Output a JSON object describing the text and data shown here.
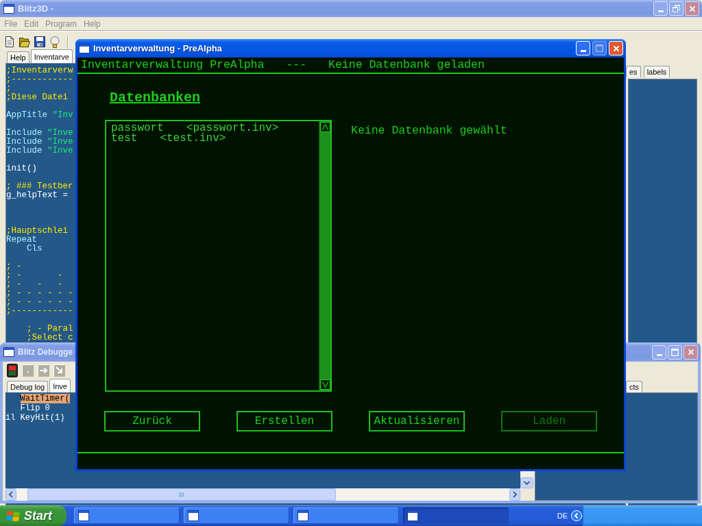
{
  "main_window": {
    "title": "Blitz3D -",
    "active": false,
    "menu": [
      "File",
      "Edit",
      "Program",
      "Help"
    ],
    "tabs": [
      {
        "label": "Help",
        "selected": false
      },
      {
        "label": "Inventarve",
        "selected": true
      }
    ],
    "code_lines": [
      {
        "kind": "code",
        "indented": false,
        "segments": [
          {
            "kind": "comment",
            "text": ";Inventarverw"
          }
        ]
      },
      {
        "kind": "code",
        "indented": false,
        "segments": [
          {
            "kind": "comment",
            "text": ";------------"
          }
        ]
      },
      {
        "kind": "code",
        "indented": false,
        "segments": [
          {
            "kind": "comment",
            "text": ";"
          }
        ]
      },
      {
        "kind": "code",
        "indented": false,
        "segments": [
          {
            "kind": "comment",
            "text": ";Diese Datei"
          }
        ]
      },
      {
        "kind": "blank"
      },
      {
        "kind": "code",
        "indented": false,
        "segments": [
          {
            "kind": "keyword",
            "text": "AppTitle"
          },
          {
            "kind": "string",
            "text": "\"Inv"
          }
        ]
      },
      {
        "kind": "blank"
      },
      {
        "kind": "code",
        "indented": false,
        "segments": [
          {
            "kind": "keyword",
            "text": "Include"
          },
          {
            "kind": "string",
            "text": "\"Inve"
          }
        ]
      },
      {
        "kind": "code",
        "indented": false,
        "segments": [
          {
            "kind": "keyword",
            "text": "Include"
          },
          {
            "kind": "string",
            "text": "\"Inve"
          }
        ]
      },
      {
        "kind": "code",
        "indented": false,
        "segments": [
          {
            "kind": "keyword",
            "text": "Include"
          },
          {
            "kind": "string",
            "text": "\"Inve"
          }
        ]
      },
      {
        "kind": "blank"
      },
      {
        "kind": "code",
        "indented": false,
        "segments": [
          {
            "kind": "plain",
            "text": "init()"
          }
        ]
      },
      {
        "kind": "blank"
      },
      {
        "kind": "code",
        "indented": false,
        "segments": [
          {
            "kind": "comment",
            "text": "; ### Testber"
          }
        ]
      },
      {
        "kind": "code",
        "indented": false,
        "segments": [
          {
            "kind": "plain",
            "text": "g_helpText ="
          }
        ]
      },
      {
        "kind": "blank"
      },
      {
        "kind": "blank"
      },
      {
        "kind": "blank"
      },
      {
        "kind": "code",
        "indented": false,
        "segments": [
          {
            "kind": "comment",
            "text": ";Hauptschlei"
          }
        ]
      },
      {
        "kind": "code",
        "indented": false,
        "segments": [
          {
            "kind": "keyword",
            "text": "Repeat"
          }
        ]
      },
      {
        "kind": "code",
        "indented": true,
        "segments": [
          {
            "kind": "keyword",
            "text": "Cls"
          }
        ]
      },
      {
        "kind": "blank"
      },
      {
        "kind": "code",
        "indented": false,
        "segments": [
          {
            "kind": "comment",
            "text": "; -"
          }
        ]
      },
      {
        "kind": "code",
        "indented": false,
        "segments": [
          {
            "kind": "comment",
            "text": "; -       -"
          }
        ]
      },
      {
        "kind": "code",
        "indented": false,
        "segments": [
          {
            "kind": "comment",
            "text": "; -   -   -"
          }
        ]
      },
      {
        "kind": "code",
        "indented": false,
        "segments": [
          {
            "kind": "comment",
            "text": "; - - - - - -"
          }
        ]
      },
      {
        "kind": "code",
        "indented": false,
        "segments": [
          {
            "kind": "comment",
            "text": "; - - - - - -"
          }
        ]
      },
      {
        "kind": "code",
        "indented": false,
        "segments": [
          {
            "kind": "comment",
            "text": ";------------"
          }
        ]
      },
      {
        "kind": "blank"
      },
      {
        "kind": "code",
        "indented": true,
        "segments": [
          {
            "kind": "comment",
            "text": "; - Paral"
          }
        ]
      },
      {
        "kind": "code",
        "indented": true,
        "segments": [
          {
            "kind": "comment",
            "text": ";Select c"
          }
        ]
      }
    ],
    "side_tabs": [
      {
        "label": "es",
        "selected": false
      },
      {
        "label": "labels",
        "selected": false
      }
    ]
  },
  "debugger_window": {
    "title": "Blitz Debugge",
    "active": false,
    "tabs": [
      {
        "label": "Debug log",
        "selected": false
      },
      {
        "label": "Inve",
        "selected": true
      }
    ],
    "code_lines": [
      {
        "statement": "WaitTimer(",
        "current": true
      },
      {
        "statement": "Flip 0",
        "current": false
      },
      {
        "lead": "il",
        "statement": "KeyHit(1)",
        "current": false
      }
    ],
    "side_tabs": [
      {
        "label": "cts",
        "selected": false
      }
    ]
  },
  "dialog": {
    "title": "Inventarverwaltung - PreAlpha",
    "active": true,
    "maximize_enabled": false,
    "header": {
      "app_name": "Inventarverwaltung PreAlpha",
      "separator": "---",
      "status": "Keine Datenbank geladen"
    },
    "section_title": "Datenbanken",
    "databases": [
      {
        "name": "passwort",
        "file": "<passwort.inv>",
        "selected": false
      },
      {
        "name": "test",
        "file": "<test.inv>",
        "selected": false
      }
    ],
    "selection_info": "Keine Datenbank gewählt",
    "buttons": [
      {
        "label": "Zurück",
        "disabled": false
      },
      {
        "label": "Erstellen",
        "disabled": false
      },
      {
        "label": "Aktualisieren",
        "disabled": false
      },
      {
        "label": "Laden",
        "disabled": true
      }
    ]
  },
  "taskbar": {
    "start_label": "Start",
    "tasks": [
      {
        "selected": false
      },
      {
        "selected": false
      },
      {
        "selected": false
      },
      {
        "selected": true
      }
    ],
    "language": "DE"
  }
}
